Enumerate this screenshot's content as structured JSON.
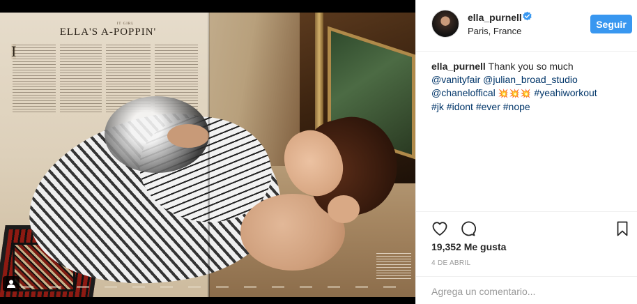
{
  "post": {
    "image_alt": "Magazine spread: Ella's A-Poppin'",
    "magazine": {
      "kicker": "IT GIRL",
      "headline": "ELLA'S A-POPPIN'"
    }
  },
  "header": {
    "username": "ella_purnell",
    "verified": true,
    "location": "Paris, France",
    "follow_label": "Seguir"
  },
  "caption": {
    "author": "ella_purnell",
    "text": "Thank you so much",
    "mentions": [
      "@vanityfair",
      "@julian_broad_studio",
      "@chaneloffical"
    ],
    "hashtags_line1": [
      "#yeahiworkout"
    ],
    "hashtags_line2": [
      "#jk",
      "#idont",
      "#ever",
      "#nope"
    ],
    "emoji": "💥💥💥"
  },
  "stats": {
    "likes": "19,352 Me gusta",
    "date": "4 DE ABRIL"
  },
  "comment": {
    "placeholder": "Agrega un comentario..."
  },
  "icons": {
    "like": "heart-icon",
    "comment": "comment-icon",
    "save": "bookmark-icon",
    "verified": "verified-badge-icon",
    "user_tag": "user-tag-icon"
  },
  "colors": {
    "follow_button": "#3897f0",
    "link": "#003569",
    "muted": "#999999",
    "verified": "#3897f0"
  }
}
